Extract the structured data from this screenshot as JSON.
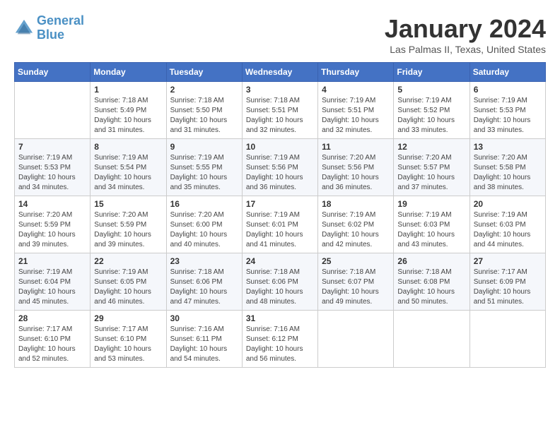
{
  "header": {
    "logo_line1": "General",
    "logo_line2": "Blue",
    "title": "January 2024",
    "subtitle": "Las Palmas II, Texas, United States"
  },
  "weekdays": [
    "Sunday",
    "Monday",
    "Tuesday",
    "Wednesday",
    "Thursday",
    "Friday",
    "Saturday"
  ],
  "weeks": [
    [
      {
        "day": "",
        "info": ""
      },
      {
        "day": "1",
        "info": "Sunrise: 7:18 AM\nSunset: 5:49 PM\nDaylight: 10 hours\nand 31 minutes."
      },
      {
        "day": "2",
        "info": "Sunrise: 7:18 AM\nSunset: 5:50 PM\nDaylight: 10 hours\nand 31 minutes."
      },
      {
        "day": "3",
        "info": "Sunrise: 7:18 AM\nSunset: 5:51 PM\nDaylight: 10 hours\nand 32 minutes."
      },
      {
        "day": "4",
        "info": "Sunrise: 7:19 AM\nSunset: 5:51 PM\nDaylight: 10 hours\nand 32 minutes."
      },
      {
        "day": "5",
        "info": "Sunrise: 7:19 AM\nSunset: 5:52 PM\nDaylight: 10 hours\nand 33 minutes."
      },
      {
        "day": "6",
        "info": "Sunrise: 7:19 AM\nSunset: 5:53 PM\nDaylight: 10 hours\nand 33 minutes."
      }
    ],
    [
      {
        "day": "7",
        "info": "Sunrise: 7:19 AM\nSunset: 5:53 PM\nDaylight: 10 hours\nand 34 minutes."
      },
      {
        "day": "8",
        "info": "Sunrise: 7:19 AM\nSunset: 5:54 PM\nDaylight: 10 hours\nand 34 minutes."
      },
      {
        "day": "9",
        "info": "Sunrise: 7:19 AM\nSunset: 5:55 PM\nDaylight: 10 hours\nand 35 minutes."
      },
      {
        "day": "10",
        "info": "Sunrise: 7:19 AM\nSunset: 5:56 PM\nDaylight: 10 hours\nand 36 minutes."
      },
      {
        "day": "11",
        "info": "Sunrise: 7:20 AM\nSunset: 5:56 PM\nDaylight: 10 hours\nand 36 minutes."
      },
      {
        "day": "12",
        "info": "Sunrise: 7:20 AM\nSunset: 5:57 PM\nDaylight: 10 hours\nand 37 minutes."
      },
      {
        "day": "13",
        "info": "Sunrise: 7:20 AM\nSunset: 5:58 PM\nDaylight: 10 hours\nand 38 minutes."
      }
    ],
    [
      {
        "day": "14",
        "info": "Sunrise: 7:20 AM\nSunset: 5:59 PM\nDaylight: 10 hours\nand 39 minutes."
      },
      {
        "day": "15",
        "info": "Sunrise: 7:20 AM\nSunset: 5:59 PM\nDaylight: 10 hours\nand 39 minutes."
      },
      {
        "day": "16",
        "info": "Sunrise: 7:20 AM\nSunset: 6:00 PM\nDaylight: 10 hours\nand 40 minutes."
      },
      {
        "day": "17",
        "info": "Sunrise: 7:19 AM\nSunset: 6:01 PM\nDaylight: 10 hours\nand 41 minutes."
      },
      {
        "day": "18",
        "info": "Sunrise: 7:19 AM\nSunset: 6:02 PM\nDaylight: 10 hours\nand 42 minutes."
      },
      {
        "day": "19",
        "info": "Sunrise: 7:19 AM\nSunset: 6:03 PM\nDaylight: 10 hours\nand 43 minutes."
      },
      {
        "day": "20",
        "info": "Sunrise: 7:19 AM\nSunset: 6:03 PM\nDaylight: 10 hours\nand 44 minutes."
      }
    ],
    [
      {
        "day": "21",
        "info": "Sunrise: 7:19 AM\nSunset: 6:04 PM\nDaylight: 10 hours\nand 45 minutes."
      },
      {
        "day": "22",
        "info": "Sunrise: 7:19 AM\nSunset: 6:05 PM\nDaylight: 10 hours\nand 46 minutes."
      },
      {
        "day": "23",
        "info": "Sunrise: 7:18 AM\nSunset: 6:06 PM\nDaylight: 10 hours\nand 47 minutes."
      },
      {
        "day": "24",
        "info": "Sunrise: 7:18 AM\nSunset: 6:06 PM\nDaylight: 10 hours\nand 48 minutes."
      },
      {
        "day": "25",
        "info": "Sunrise: 7:18 AM\nSunset: 6:07 PM\nDaylight: 10 hours\nand 49 minutes."
      },
      {
        "day": "26",
        "info": "Sunrise: 7:18 AM\nSunset: 6:08 PM\nDaylight: 10 hours\nand 50 minutes."
      },
      {
        "day": "27",
        "info": "Sunrise: 7:17 AM\nSunset: 6:09 PM\nDaylight: 10 hours\nand 51 minutes."
      }
    ],
    [
      {
        "day": "28",
        "info": "Sunrise: 7:17 AM\nSunset: 6:10 PM\nDaylight: 10 hours\nand 52 minutes."
      },
      {
        "day": "29",
        "info": "Sunrise: 7:17 AM\nSunset: 6:10 PM\nDaylight: 10 hours\nand 53 minutes."
      },
      {
        "day": "30",
        "info": "Sunrise: 7:16 AM\nSunset: 6:11 PM\nDaylight: 10 hours\nand 54 minutes."
      },
      {
        "day": "31",
        "info": "Sunrise: 7:16 AM\nSunset: 6:12 PM\nDaylight: 10 hours\nand 56 minutes."
      },
      {
        "day": "",
        "info": ""
      },
      {
        "day": "",
        "info": ""
      },
      {
        "day": "",
        "info": ""
      }
    ]
  ]
}
